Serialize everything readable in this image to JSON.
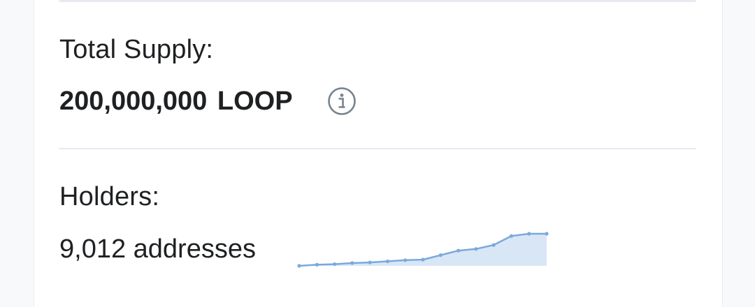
{
  "total_supply": {
    "label": "Total Supply:",
    "amount": "200,000,000",
    "unit": "LOOP",
    "info_icon": "info-circle-icon"
  },
  "holders": {
    "label": "Holders:",
    "value": "9,012 addresses"
  },
  "colors": {
    "text": "#1e2022",
    "divider": "#e7eaf3",
    "sparkline_line": "#7aa9dc",
    "sparkline_fill": "#d9e6f6",
    "icon": "#77838f"
  },
  "chart_data": {
    "type": "area",
    "values": [
      0,
      2,
      3,
      5,
      6,
      8,
      10,
      11,
      19,
      27,
      30,
      37,
      53,
      57,
      57
    ]
  }
}
